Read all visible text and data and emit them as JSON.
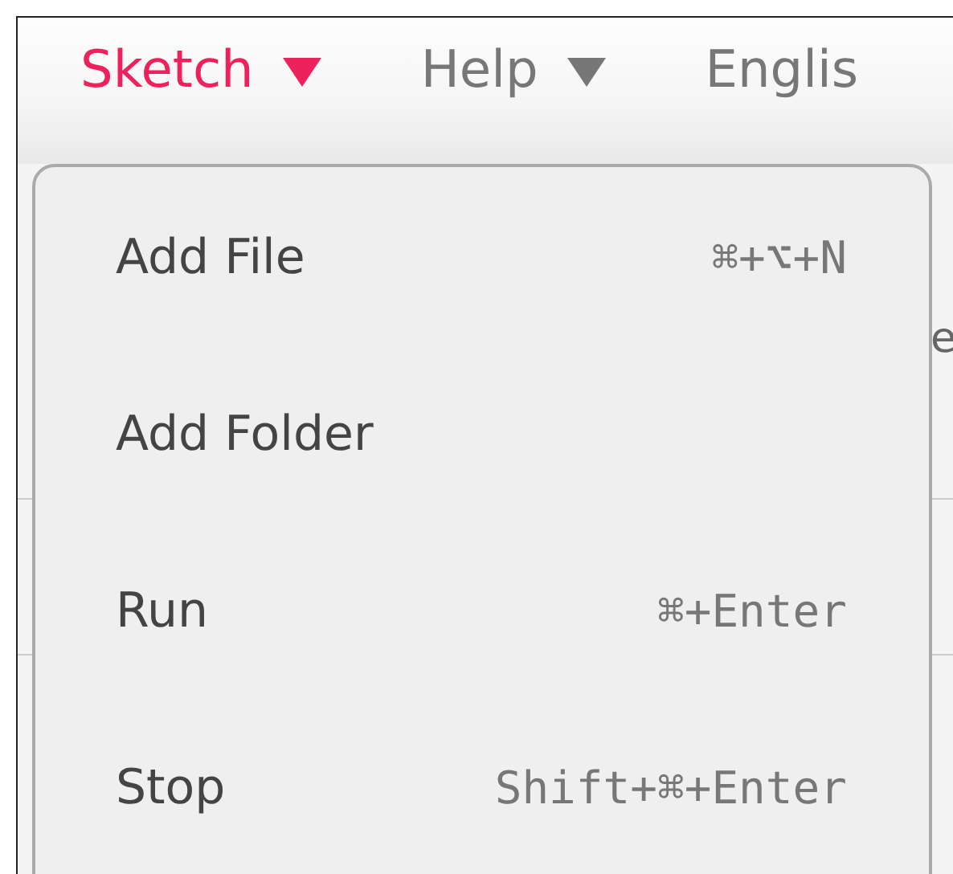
{
  "nav": [
    {
      "label": "Sketch",
      "selected": true
    },
    {
      "label": "Help",
      "selected": false
    },
    {
      "label": "Englis",
      "selected": false
    }
  ],
  "background_text": "e",
  "menu": {
    "items": [
      {
        "label": "Add File",
        "shortcut": "⌘+⌥+N"
      },
      {
        "label": "Add Folder"
      },
      {
        "label": "Run",
        "shortcut": "⌘+Enter"
      },
      {
        "label": "Stop",
        "shortcut": "Shift+⌘+Enter"
      }
    ]
  }
}
